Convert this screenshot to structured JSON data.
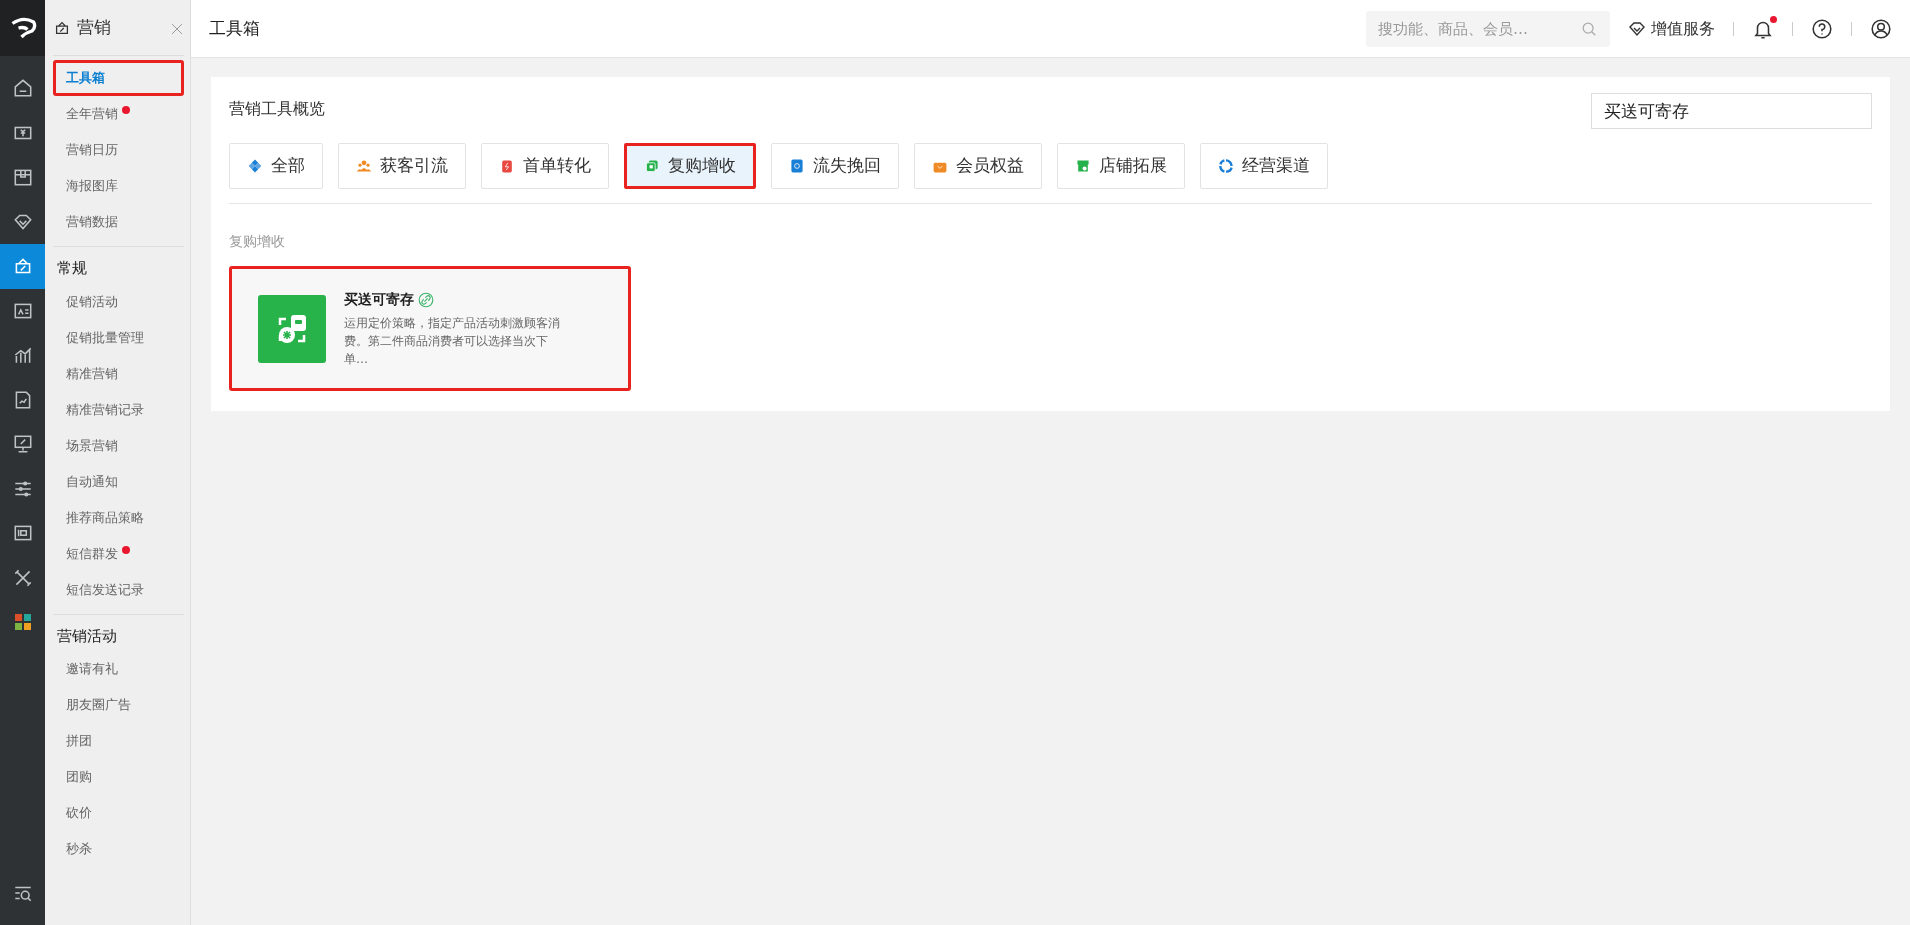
{
  "rail": [
    {
      "selected": false
    },
    {
      "selected": false
    },
    {
      "selected": false
    },
    {
      "selected": false
    },
    {
      "selected": true
    },
    {
      "selected": false
    },
    {
      "selected": false
    },
    {
      "selected": false
    },
    {
      "selected": false
    },
    {
      "selected": false
    },
    {
      "selected": false
    },
    {
      "selected": false
    }
  ],
  "sidebar": {
    "title": "营销",
    "groups": [
      {
        "items": [
          {
            "label": "工具箱",
            "selected": true,
            "dot": false,
            "annotated": true
          },
          {
            "label": "全年营销",
            "selected": false,
            "dot": true,
            "annotated": false
          },
          {
            "label": "营销日历",
            "selected": false,
            "dot": false,
            "annotated": false
          },
          {
            "label": "海报图库",
            "selected": false,
            "dot": false,
            "annotated": false
          },
          {
            "label": "营销数据",
            "selected": false,
            "dot": false,
            "annotated": false
          }
        ]
      },
      {
        "heading": "常规",
        "items": [
          {
            "label": "促销活动",
            "selected": false,
            "dot": false,
            "annotated": false
          },
          {
            "label": "促销批量管理",
            "selected": false,
            "dot": false,
            "annotated": false
          },
          {
            "label": "精准营销",
            "selected": false,
            "dot": false,
            "annotated": false
          },
          {
            "label": "精准营销记录",
            "selected": false,
            "dot": false,
            "annotated": false
          },
          {
            "label": "场景营销",
            "selected": false,
            "dot": false,
            "annotated": false
          },
          {
            "label": "自动通知",
            "selected": false,
            "dot": false,
            "annotated": false
          },
          {
            "label": "推荐商品策略",
            "selected": false,
            "dot": false,
            "annotated": false
          },
          {
            "label": "短信群发",
            "selected": false,
            "dot": true,
            "annotated": false
          },
          {
            "label": "短信发送记录",
            "selected": false,
            "dot": false,
            "annotated": false
          }
        ]
      },
      {
        "heading": "营销活动",
        "items": [
          {
            "label": "邀请有礼",
            "selected": false,
            "dot": false,
            "annotated": false
          },
          {
            "label": "朋友圈广告",
            "selected": false,
            "dot": false,
            "annotated": false
          },
          {
            "label": "拼团",
            "selected": false,
            "dot": false,
            "annotated": false
          },
          {
            "label": "团购",
            "selected": false,
            "dot": false,
            "annotated": false
          },
          {
            "label": "砍价",
            "selected": false,
            "dot": false,
            "annotated": false
          },
          {
            "label": "秒杀",
            "selected": false,
            "dot": false,
            "annotated": false
          }
        ]
      }
    ]
  },
  "topbar": {
    "title": "工具箱",
    "search": {
      "placeholder": "搜功能、商品、会员…"
    },
    "service": "增值服务",
    "notification_dot": true
  },
  "panel": {
    "title": "营销工具概览",
    "search": {
      "value": "买送可寄存"
    },
    "tabs": [
      {
        "label": "全部",
        "selected": false,
        "annotated": false,
        "color": "#1a7fd6"
      },
      {
        "label": "获客引流",
        "selected": false,
        "annotated": false,
        "color": "#f08a24"
      },
      {
        "label": "首单转化",
        "selected": false,
        "annotated": false,
        "color": "#e8483f"
      },
      {
        "label": "复购增收",
        "selected": true,
        "annotated": true,
        "color": "#25b14b"
      },
      {
        "label": "流失挽回",
        "selected": false,
        "annotated": false,
        "color": "#1a7fd6"
      },
      {
        "label": "会员权益",
        "selected": false,
        "annotated": false,
        "color": "#f08a24"
      },
      {
        "label": "店铺拓展",
        "selected": false,
        "annotated": false,
        "color": "#25b14b"
      },
      {
        "label": "经营渠道",
        "selected": false,
        "annotated": false,
        "color": "#1a7fd6"
      }
    ],
    "section": "复购增收",
    "cards": [
      {
        "title": "买送可寄存",
        "description": "运用定价策略，指定产品活动刺激顾客消费。第二件商品消费者可以选择当次下单…",
        "annotated": true
      }
    ]
  }
}
